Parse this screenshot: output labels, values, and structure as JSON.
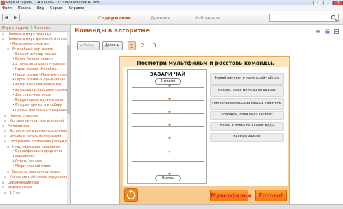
{
  "window": {
    "title": "Игры и задачи, 1-4 классы - 1С:Образование 4. Дом",
    "min": "–",
    "max": "□",
    "close": "✕"
  },
  "menu": [
    "Файл",
    "Правка",
    "Вид",
    "Сервис",
    "Справка"
  ],
  "toolbar": {
    "back": "◀",
    "forward": "▶",
    "tabs": [
      "Содержание",
      "Дневник",
      "Избранное"
    ],
    "search_placeholder": ""
  },
  "sidebar": {
    "header": "Игры и задачи, 1-4 классы",
    "items": [
      {
        "exp": "⊞",
        "bullet": "",
        "text": "Человек в мире природы"
      },
      {
        "exp": "⊟",
        "bullet": "",
        "text": "Человек в мире фантазий и сказок"
      },
      {
        "exp": "",
        "bullet": "•",
        "text": "Маленькие открытия"
      },
      {
        "exp": "⊟",
        "bullet": "",
        "text": "Волшебный мир сказок"
      },
      {
        "exp": "",
        "bullet": "•",
        "text": "Волшебный мир сказок"
      },
      {
        "exp": "",
        "bullet": "•",
        "text": "Какие бывают сказки"
      },
      {
        "exp": "",
        "bullet": "•",
        "text": "А. Пушкин «Сказка о рыбаке и рыбке»"
      },
      {
        "exp": "",
        "bullet": "•",
        "text": "Герои сказки «Колобок»"
      },
      {
        "exp": "",
        "bullet": "•",
        "text": "Герои сказки «Мальчик-с-пальчик»"
      },
      {
        "exp": "",
        "bullet": "•",
        "text": "Герои сказки «Царь-девица»"
      },
      {
        "exp": "",
        "bullet": "•",
        "text": "Автор и его сказочный мир"
      },
      {
        "exp": "",
        "bullet": "•",
        "text": "Авторская и народная сказка"
      },
      {
        "exp": "",
        "bullet": "•",
        "text": "Два сказочных мира"
      },
      {
        "exp": "",
        "bullet": "•",
        "text": "Найди героев одной сказки"
      },
      {
        "exp": "",
        "bullet": "•",
        "text": "Истории про кота и собаку"
      },
      {
        "exp": "",
        "bullet": "•",
        "text": "Сравни две сказки о Морозке"
      },
      {
        "exp": "⊞",
        "bullet": "",
        "text": "Немного теории"
      },
      {
        "exp": "⊞",
        "bullet": "",
        "text": "История литературы для детей"
      },
      {
        "exp": "⊟",
        "bullet": "",
        "text": "Математика"
      },
      {
        "exp": "⊞",
        "bullet": "",
        "text": "Вычисления в различных системах"
      },
      {
        "exp": "⊞",
        "bullet": "",
        "text": "Чтение и запись информации"
      },
      {
        "exp": "⊟",
        "bullet": "",
        "text": "Построение логических рассуждений"
      },
      {
        "exp": "⊟",
        "bullet": "",
        "text": "Классификация, сравнение"
      },
      {
        "exp": "",
        "bullet": "•",
        "text": "Классификация предметов"
      },
      {
        "exp": "",
        "bullet": "•",
        "text": "Множества"
      },
      {
        "exp": "",
        "bullet": "•",
        "text": "Ответь лишнее"
      },
      {
        "exp": "",
        "bullet": "•",
        "text": "Убери лишний ответ"
      },
      {
        "exp": "⊞",
        "bullet": "",
        "text": "Решение логических задач"
      },
      {
        "exp": "⊞",
        "bullet": "",
        "text": "Ухожение в объектах окружения"
      },
      {
        "exp": "⊞",
        "bullet": "",
        "text": "Окружающий мир"
      },
      {
        "exp": "⊟",
        "bullet": "",
        "text": "Информатика"
      },
      {
        "exp": "⊞",
        "bullet": "",
        "text": "1-7 лет"
      }
    ]
  },
  "main": {
    "title": "Команды в алгоритме",
    "pager": {
      "prev": "◀ Назад",
      "next": "Далее ▶",
      "pages": [
        "1",
        "2",
        "3"
      ],
      "active_page": "1"
    },
    "exercise": {
      "heading": "Посмотри мультфильм и расставь команды.",
      "task": "ЗАВАРИ ЧАЙ",
      "start": "Начало",
      "end": "Конец",
      "commands": [
        "Налей кипяток в маленький чайник",
        "Насыпь чай в маленький чайник",
        "Ополосни маленький чайник кипятком",
        "Подожди, пока вода закипит",
        "Налей в большой чайник воды",
        "Включи чайник"
      ],
      "cartoon_button": "Мультфильм",
      "done_button": "Готово!"
    }
  },
  "colors": {
    "accent": "#c0561a",
    "panel": "#f7c98a",
    "button": "#f07a0e",
    "button_text": "#e81e1e"
  }
}
